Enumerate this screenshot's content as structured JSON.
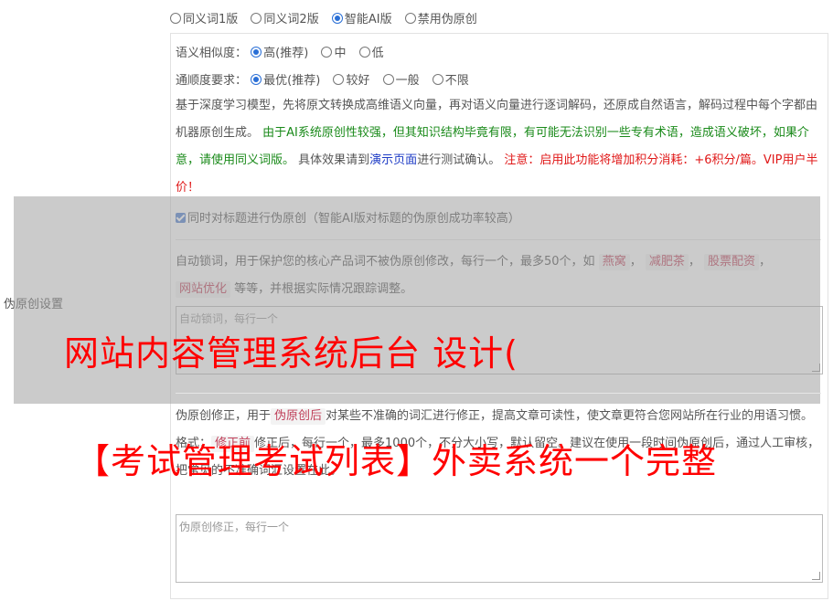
{
  "mode_options": [
    {
      "label": "同义词1版",
      "selected": false
    },
    {
      "label": "同义词2版",
      "selected": false
    },
    {
      "label": "智能AI版",
      "selected": true
    },
    {
      "label": "禁用伪原创",
      "selected": false
    }
  ],
  "similarity": {
    "label": "语义相似度：",
    "options": [
      {
        "label": "高(推荐)",
        "selected": true
      },
      {
        "label": "中",
        "selected": false
      },
      {
        "label": "低",
        "selected": false
      }
    ]
  },
  "fluency": {
    "label": "通顺度要求：",
    "options": [
      {
        "label": "最优(推荐)",
        "selected": true
      },
      {
        "label": "较好",
        "selected": false
      },
      {
        "label": "一般",
        "selected": false
      },
      {
        "label": "不限",
        "selected": false
      }
    ]
  },
  "description": {
    "p1": "基于深度学习模型，先将原文转换成高维语义向量，再对语义向量进行逐词解码，还原成自然语言，解码过程中每个字都由机器原创生成。",
    "p2": "由于AI系统原创性较强，但其知识结构毕竟有限，有可能无法识别一些专有术语，造成语义破坏，如果介意，请使用同义词版。",
    "p3": "具体效果请到",
    "link": "演示页面",
    "p4": "进行测试确认。",
    "warning": "注意：启用此功能将增加积分消耗：+6积分/篇。VIP用户半价！"
  },
  "title_checkbox": {
    "label": "同时对标题进行伪原创（智能AI版对标题的伪原创成功率较高）",
    "checked": true
  },
  "side_label": "伪原创设置",
  "lock_words": {
    "text_before": "自动锁词，用于保护您的核心产品词不被伪原创修改，每行一个，最多50个，如",
    "examples": [
      "燕窝",
      "减肥茶",
      "股票配资",
      "网站优化"
    ],
    "text_after": "等等，并根据实际情况跟踪调整。",
    "placeholder": "自动锁词，每行一个"
  },
  "correction": {
    "text_before": "伪原创修正，用于",
    "tag": "伪原创后",
    "text_mid": "对某些不准确的词汇进行修正，提高文章可读性，使文章更符合您网站所在行业的用语习惯。格式：",
    "tag2": "修正前",
    "text_mid2": "修正后，每行一个，最多1000个，不分大小写，默认留空。建议在使用一段时间伪原创后，通过人工审核，把常见的不准确词汇设置在此。",
    "placeholder": "伪原创修正，每行一个"
  },
  "watermarks": {
    "line1": "网站内容管理系统后台 设计(",
    "line2": "【考试管理考试列表】外卖系统一个完整"
  }
}
